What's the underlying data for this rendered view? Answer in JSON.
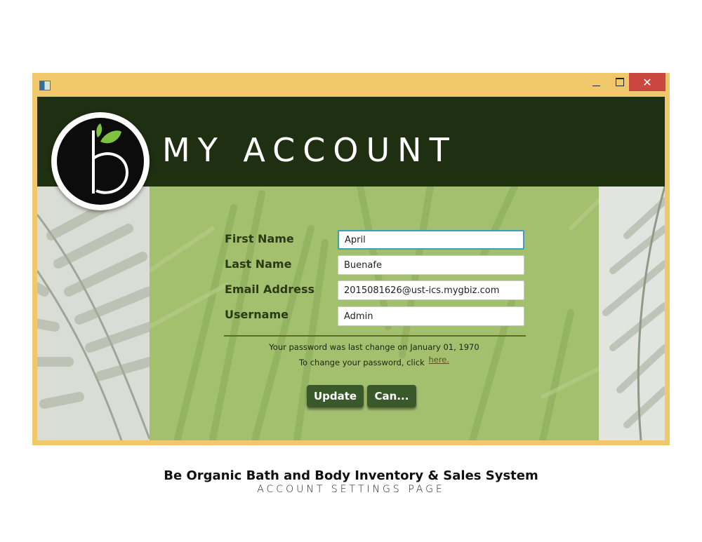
{
  "window": {
    "title_bar": {
      "close_glyph": "✕"
    }
  },
  "header": {
    "title": "MY ACCOUNT",
    "colors": {
      "header_bg": "#1e3011",
      "panel_bg": "#a3c06f",
      "button_bg": "#39592a",
      "window_frame": "#f1c76b",
      "close_button": "#c9473f"
    }
  },
  "logo": {
    "icon": "brand-logo-b-leaf"
  },
  "form": {
    "fields": [
      {
        "label": "First Name",
        "value": "April",
        "focused": true
      },
      {
        "label": "Last Name",
        "value": "Buenafe",
        "focused": false
      },
      {
        "label": "Email Address",
        "value": "2015081626@ust-ics.mygbiz.com",
        "focused": false
      },
      {
        "label": "Username",
        "value": "Admin",
        "focused": false
      }
    ],
    "password_info": "Your password was last change on January 01, 1970",
    "change_prompt": "To change your password, click",
    "change_link": "here.",
    "buttons": {
      "update": "Update",
      "cancel": "Can..."
    }
  },
  "caption": {
    "title": "Be Organic Bath and Body Inventory & Sales System",
    "subtitle": "ACCOUNT SETTINGS PAGE"
  }
}
